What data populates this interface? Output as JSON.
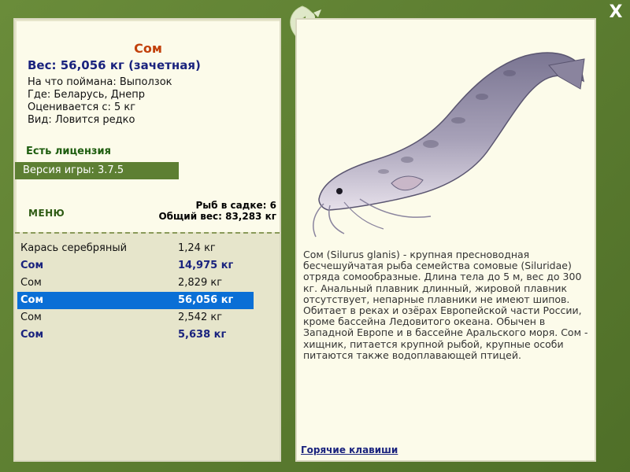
{
  "window": {
    "close_symbol": "X"
  },
  "fish": {
    "title": "Сом",
    "weight_line": "Вес: 56,056 кг (зачетная)",
    "details": [
      "На что поймана: Выползок",
      "Где: Беларусь, Днепр",
      "Оценивается с: 5 кг",
      "Вид: Ловится редко"
    ]
  },
  "license_text": "Есть лицензия",
  "version_text": "Версия игры: 3.7.5",
  "menu_label": "МЕНЮ",
  "cage": {
    "count_line": "Рыб в садке: 6",
    "total_line": "Общий вес: 83,283 кг"
  },
  "fish_list": [
    {
      "name": "Карась серебряный",
      "weight": "1,24 кг",
      "trophy": false,
      "selected": false
    },
    {
      "name": "Сом",
      "weight": "14,975 кг",
      "trophy": true,
      "selected": false
    },
    {
      "name": "Сом",
      "weight": "2,829 кг",
      "trophy": false,
      "selected": false
    },
    {
      "name": "Сом",
      "weight": "56,056 кг",
      "trophy": true,
      "selected": true
    },
    {
      "name": "Сом",
      "weight": "2,542 кг",
      "trophy": false,
      "selected": false
    },
    {
      "name": "Сом",
      "weight": "5,638 кг",
      "trophy": true,
      "selected": false
    }
  ],
  "description": "Сом (Silurus glanis) - крупная пресноводная бесчешуйчатая рыба семейства сомовые (Siluridae) отряда сомообразные. Длина тела до 5 м, вес до 300 кг. Анальный плавник длинный, жировой плавник отсутствует, непарные плавники не имеют шипов. Обитает в реках и озёрах Европейской части России, кроме бассейна Ледовитого океана. Обычен в Западной Европе и в бассейне Аральского моря. Сом - хищник, питается крупной рыбой, крупные особи питаются также водоплавающей птицей.",
  "hotkeys_label": "Горячие клавиши",
  "colors": {
    "frame": "#58792f",
    "selected_row": "#0a6fd6",
    "trophy_text": "#1a237e",
    "title_text": "#c2410c"
  }
}
